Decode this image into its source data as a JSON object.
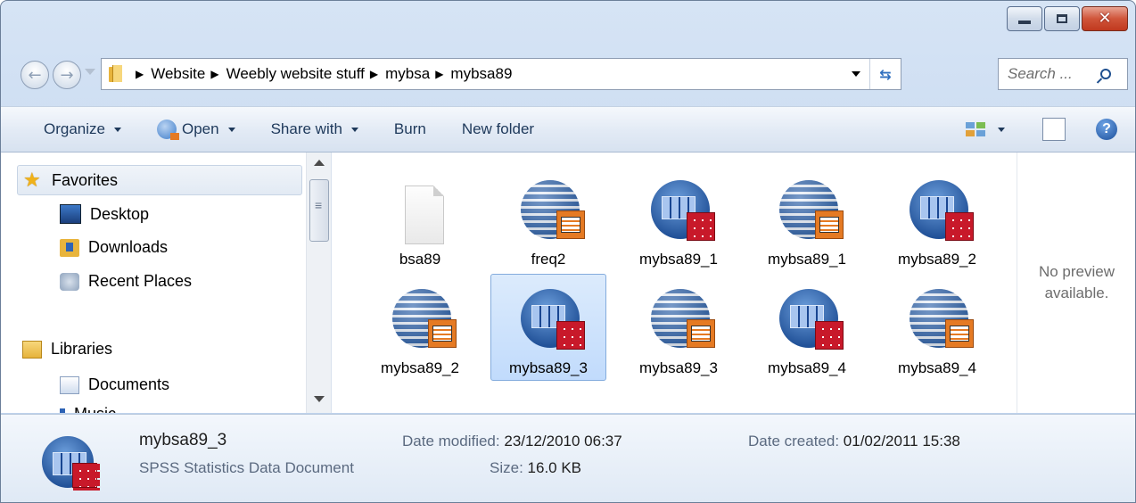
{
  "window": {
    "caption": {
      "minimize": "—",
      "maximize": "□",
      "close": "✕"
    }
  },
  "address": {
    "crumbs": [
      "Website",
      "Weebly website stuff",
      "mybsa",
      "mybsa89"
    ]
  },
  "search": {
    "placeholder": "Search ..."
  },
  "toolbar": {
    "organize": "Organize",
    "open": "Open",
    "share_with": "Share with",
    "burn": "Burn",
    "new_folder": "New folder"
  },
  "nav": {
    "favorites": "Favorites",
    "desktop": "Desktop",
    "downloads": "Downloads",
    "recent_places": "Recent Places",
    "libraries": "Libraries",
    "documents": "Documents",
    "music": "Music"
  },
  "files": [
    {
      "name": "bsa89",
      "kind": "blank"
    },
    {
      "name": "freq2",
      "kind": "output"
    },
    {
      "name": "mybsa89_1",
      "kind": "data"
    },
    {
      "name": "mybsa89_1",
      "kind": "output"
    },
    {
      "name": "mybsa89_2",
      "kind": "data"
    },
    {
      "name": "mybsa89_2",
      "kind": "output"
    },
    {
      "name": "mybsa89_3",
      "kind": "data",
      "selected": true
    },
    {
      "name": "mybsa89_3",
      "kind": "output"
    },
    {
      "name": "mybsa89_4",
      "kind": "data"
    },
    {
      "name": "mybsa89_4",
      "kind": "output"
    }
  ],
  "preview": {
    "message": "No preview available."
  },
  "details": {
    "name": "mybsa89_3",
    "type": "SPSS Statistics Data Document",
    "date_modified_label": "Date modified:",
    "date_modified": "23/12/2010 06:37",
    "size_label": "Size:",
    "size": "16.0 KB",
    "date_created_label": "Date created:",
    "date_created": "01/02/2011 15:38"
  }
}
